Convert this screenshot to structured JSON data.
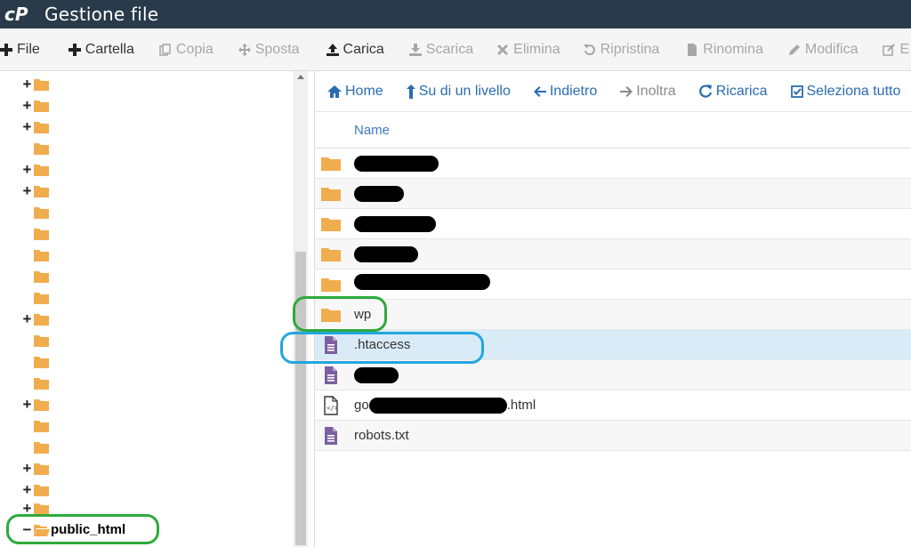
{
  "header": {
    "title": "Gestione file",
    "logo": "cP"
  },
  "toolbar": {
    "items": [
      {
        "label": "File",
        "icon": "plus-icon",
        "enabled": true
      },
      {
        "label": "Cartella",
        "icon": "plus-icon",
        "enabled": true
      },
      {
        "label": "Copia",
        "icon": "copy-icon",
        "enabled": false
      },
      {
        "label": "Sposta",
        "icon": "move-icon",
        "enabled": false
      },
      {
        "label": "Carica",
        "icon": "upload-icon",
        "enabled": true
      },
      {
        "label": "Scarica",
        "icon": "download-icon",
        "enabled": false
      },
      {
        "label": "Elimina",
        "icon": "delete-icon",
        "enabled": false
      },
      {
        "label": "Ripristina",
        "icon": "restore-icon",
        "enabled": false
      },
      {
        "label": "Rinomina",
        "icon": "file-icon",
        "enabled": false
      },
      {
        "label": "Modifica",
        "icon": "pencil-icon",
        "enabled": false
      },
      {
        "label": "E",
        "icon": "edit-icon",
        "enabled": false
      }
    ]
  },
  "navbar": {
    "items": [
      {
        "label": "Home",
        "icon": "home-icon",
        "enabled": true
      },
      {
        "label": "Su di un livello",
        "icon": "level-up-icon",
        "enabled": true
      },
      {
        "label": "Indietro",
        "icon": "arrow-left-icon",
        "enabled": true
      },
      {
        "label": "Inoltra",
        "icon": "arrow-right-icon",
        "enabled": false
      },
      {
        "label": "Ricarica",
        "icon": "refresh-icon",
        "enabled": true
      },
      {
        "label": "Seleziona tutto",
        "icon": "checkbox-icon",
        "enabled": true
      }
    ]
  },
  "tree": {
    "rows": [
      {
        "toggle": "+",
        "label": ""
      },
      {
        "toggle": "+",
        "label": ""
      },
      {
        "toggle": "+",
        "label": ""
      },
      {
        "toggle": "",
        "label": ""
      },
      {
        "toggle": "+",
        "label": ""
      },
      {
        "toggle": "+",
        "label": ""
      },
      {
        "toggle": "",
        "label": ""
      },
      {
        "toggle": "",
        "label": ""
      },
      {
        "toggle": "",
        "label": ""
      },
      {
        "toggle": "",
        "label": ""
      },
      {
        "toggle": "",
        "label": ""
      },
      {
        "toggle": "+",
        "label": ""
      },
      {
        "toggle": "",
        "label": ""
      },
      {
        "toggle": "",
        "label": ""
      },
      {
        "toggle": "",
        "label": ""
      },
      {
        "toggle": "+",
        "label": ""
      },
      {
        "toggle": "",
        "label": ""
      },
      {
        "toggle": "",
        "label": ""
      },
      {
        "toggle": "+",
        "label": ""
      },
      {
        "toggle": "+",
        "label": ""
      },
      {
        "toggle": "+",
        "label": ""
      },
      {
        "toggle": "−",
        "label": "public_html",
        "open": true
      }
    ]
  },
  "table": {
    "header": "Name",
    "rows": [
      {
        "type": "folder",
        "name": "",
        "prefix": "",
        "suffix": "",
        "redacted": true
      },
      {
        "type": "folder",
        "name": "",
        "prefix": "",
        "suffix": "",
        "redacted": true
      },
      {
        "type": "folder",
        "name": "",
        "prefix": "",
        "suffix": "",
        "redacted": true
      },
      {
        "type": "folder",
        "name": "",
        "prefix": "",
        "suffix": "",
        "redacted": true
      },
      {
        "type": "folder",
        "name": "",
        "prefix": "",
        "suffix": "",
        "redacted": true
      },
      {
        "type": "folder",
        "name": "wp",
        "redacted": false
      },
      {
        "type": "text",
        "name": ".htaccess",
        "redacted": false,
        "selected": true
      },
      {
        "type": "text",
        "name": "",
        "prefix": "",
        "suffix": "",
        "redacted": true
      },
      {
        "type": "html",
        "name": "",
        "prefix": "go",
        "suffix": ".html",
        "redacted": true
      },
      {
        "type": "text",
        "name": "robots.txt",
        "redacted": false
      }
    ]
  },
  "colors": {
    "header_bg": "#293a4a",
    "folder": "#f0ad4e",
    "text_file": "#7b5fa0",
    "link": "#2a6cb0",
    "selected_row": "#d9ebf7",
    "annotation_green": "#2eaa3c",
    "annotation_blue": "#22a6de"
  }
}
